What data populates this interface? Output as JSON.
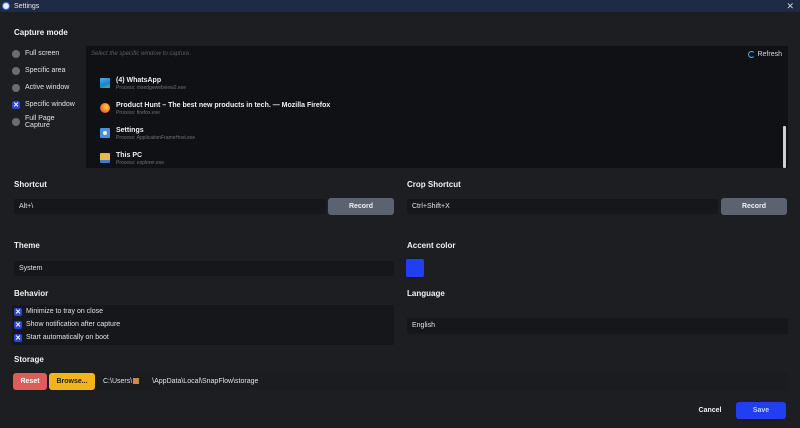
{
  "window": {
    "title": "Settings",
    "close_glyph": "✕",
    "app_icon": "app-icon"
  },
  "capture": {
    "title": "Capture mode",
    "modes": [
      {
        "label": "Full screen",
        "checked": false
      },
      {
        "label": "Specific area",
        "checked": false
      },
      {
        "label": "Active window",
        "checked": false
      },
      {
        "label": "Specific window",
        "checked": true
      },
      {
        "label": "Full Page Capture",
        "checked": false
      }
    ],
    "search_placeholder": "Select the specific window to capture.",
    "refresh_label": "Refresh",
    "windows": [
      {
        "name": "(4) WhatsApp",
        "process": "Process: msedgewebview2.exe",
        "icon": "whatsapp-icon"
      },
      {
        "name": "Product Hunt – The best new products in tech. — Mozilla Firefox",
        "process": "Process: firefox.exe",
        "icon": "firefox-icon"
      },
      {
        "name": "Settings",
        "process": "Process: ApplicationFrameHost.exe",
        "icon": "settings-app-icon"
      },
      {
        "name": "This PC",
        "process": "Process: explorer.exe",
        "icon": "this-pc-icon"
      }
    ]
  },
  "shortcut": {
    "title": "Shortcut",
    "value": "Alt+\\",
    "record_label": "Record"
  },
  "crop_shortcut": {
    "title": "Crop Shortcut",
    "value": "Ctrl+Shift+X",
    "record_label": "Record"
  },
  "theme": {
    "title": "Theme",
    "value": "System"
  },
  "accent": {
    "title": "Accent color",
    "color": "#1f3ff0"
  },
  "behavior": {
    "title": "Behavior",
    "options": [
      {
        "label": "Minimize to tray on close",
        "checked": true
      },
      {
        "label": "Show notification after capture",
        "checked": true
      },
      {
        "label": "Start automatically on boot",
        "checked": true
      }
    ]
  },
  "language": {
    "title": "Language",
    "value": "English"
  },
  "storage": {
    "title": "Storage",
    "reset_label": "Reset",
    "browse_label": "Browse...",
    "path_prefix": "C:\\Users\\",
    "path_suffix": "\\AppData\\Local\\SnapFlow\\storage"
  },
  "footer": {
    "cancel_label": "Cancel",
    "save_label": "Save"
  },
  "colors": {
    "accent": "#1f3ff0",
    "reset": "#e05c5c",
    "browse": "#f2b418",
    "record": "#5b6270"
  }
}
